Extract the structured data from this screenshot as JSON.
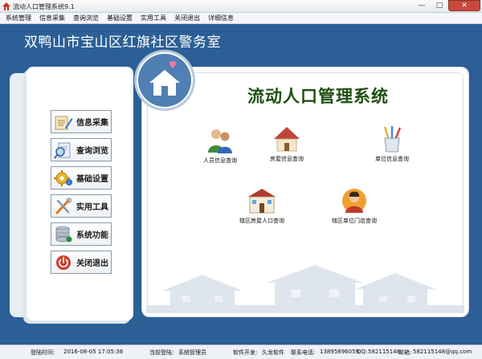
{
  "window": {
    "title": "流动人口管理系统9.1",
    "min_label": "—",
    "max_label": "□",
    "close_label": "✕"
  },
  "menu": [
    "系统管理",
    "信息采集",
    "查询浏览",
    "基础设置",
    "实用工具",
    "关闭退出",
    "详细信息"
  ],
  "header": {
    "title": "双鸭山市宝山区红旗社区警务室"
  },
  "sidebar": {
    "items": [
      {
        "label": "信息采集",
        "icon": "clipboard-pencil-icon"
      },
      {
        "label": "查询浏览",
        "icon": "magnifier-document-icon"
      },
      {
        "label": "基础设置",
        "icon": "gear-icon"
      },
      {
        "label": "实用工具",
        "icon": "wrench-screwdriver-icon"
      },
      {
        "label": "系统功能",
        "icon": "database-icon"
      },
      {
        "label": "关闭退出",
        "icon": "power-icon"
      }
    ]
  },
  "main": {
    "title": "流动人口管理系统",
    "functions": [
      {
        "label": "人员信息查询",
        "icon": "people-icon"
      },
      {
        "label": "房屋信息查询",
        "icon": "house-icon"
      },
      {
        "label": "单位信息查询",
        "icon": "pencil-cup-icon"
      },
      {
        "label": "辖区房屋人口查询",
        "icon": "building-icon"
      },
      {
        "label": "辖区单位门店查询",
        "icon": "shop-person-icon"
      }
    ]
  },
  "status": {
    "login_time_label": "登陆时间:",
    "login_time": "2016-08-05 17:05:36",
    "current_user_label": "当前登陆:",
    "current_user": "系统管理员",
    "developer_label": "软件开发:",
    "developer": "久龙软件",
    "phone_label": "联系电话:",
    "phone": "13895896059",
    "qq_label": "QQ:",
    "qq": "582115148",
    "email_label": "邮箱:",
    "email": "582115148@qq.com"
  },
  "colors": {
    "background": "#2b5f95",
    "title_green": "#1d4f10",
    "close_red": "#c94a3c"
  }
}
